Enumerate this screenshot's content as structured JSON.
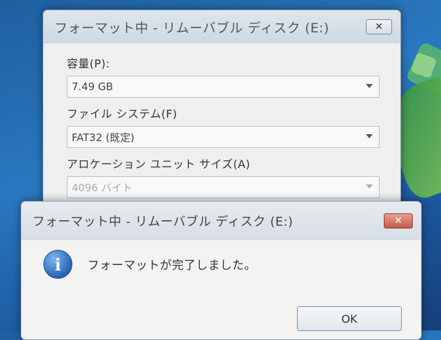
{
  "main_window": {
    "title": "フォーマット中 - リムーバブル ディスク (E:)",
    "close_label": "✕",
    "capacity": {
      "label": "容量(P):",
      "value": "7.49 GB"
    },
    "file_system": {
      "label": "ファイル システム(F)",
      "value": "FAT32 (既定)"
    },
    "allocation": {
      "label": "アロケーション ユニット サイズ(A)",
      "value": "4096 バイト"
    }
  },
  "dialog": {
    "title": "フォーマット中 - リムーバブル ディスク (E:)",
    "close_label": "✕",
    "message": "フォーマットが完了しました。",
    "ok_label": "OK",
    "icon": "info-icon",
    "icon_glyph": "i"
  },
  "colors": {
    "desktop": "#2a78c0",
    "window_bg": "#eef0f0",
    "close_red": "#c65a48",
    "info_blue": "#2565b5"
  }
}
